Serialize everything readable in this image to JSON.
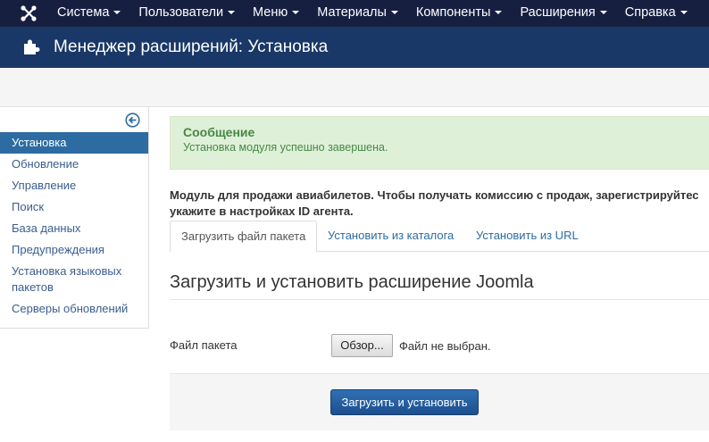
{
  "navbar": {
    "logo_icon": "joomla-logo-icon",
    "menu": [
      {
        "label": "Система"
      },
      {
        "label": "Пользователи"
      },
      {
        "label": "Меню"
      },
      {
        "label": "Материалы"
      },
      {
        "label": "Компоненты"
      },
      {
        "label": "Расширения"
      },
      {
        "label": "Справка"
      }
    ]
  },
  "header": {
    "icon": "puzzle-piece-icon",
    "title": "Менеджер расширений: Установка"
  },
  "sidebar": {
    "toggle_icon": "arrow-left-circle-icon",
    "items": [
      {
        "label": "Установка",
        "active": true
      },
      {
        "label": "Обновление"
      },
      {
        "label": "Управление"
      },
      {
        "label": "Поиск"
      },
      {
        "label": "База данных"
      },
      {
        "label": "Предупреждения"
      },
      {
        "label_line1": "Установка языковых",
        "label_line2": "пакетов"
      },
      {
        "label": "Серверы обновлений"
      }
    ]
  },
  "alert": {
    "heading": "Сообщение",
    "message": "Установка модуля успешно завершена."
  },
  "description": {
    "line1": "Модуль для продажи авиабилетов. Чтобы получать комиссию с продаж, зарегистрируйтес",
    "line2": "укажите в настройках ID агента."
  },
  "tabs": [
    {
      "label": "Загрузить файл пакета",
      "active": true
    },
    {
      "label": "Установить из каталога"
    },
    {
      "label": "Установить из URL"
    }
  ],
  "upload": {
    "section_title": "Загрузить и установить расширение Joomla",
    "field_label": "Файл пакета",
    "browse_label": "Обзор...",
    "file_status": "Файл не выбран.",
    "submit_label": "Загрузить и установить"
  },
  "colors": {
    "navbar_bg": "#171f41",
    "header_bg": "#1a3867",
    "active_blue": "#2d6ca2",
    "success_bg": "#dff0d8",
    "success_text": "#468847"
  }
}
